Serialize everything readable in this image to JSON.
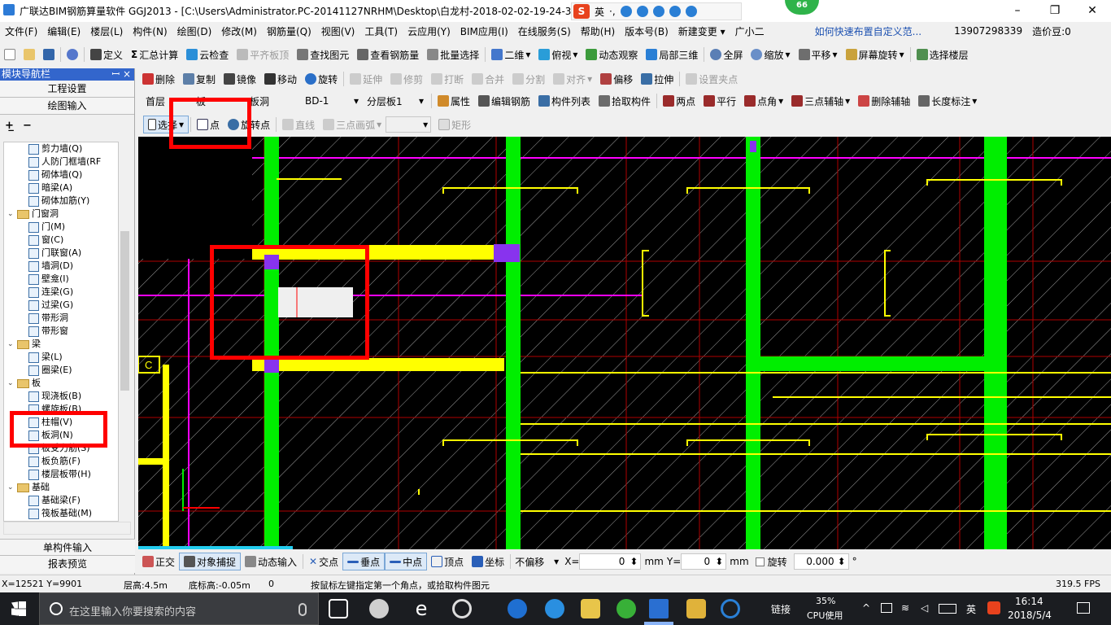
{
  "titlebar": {
    "title": "广联达BIM钢筋算量软件 GGJ2013 - [C:\\Users\\Administrator.PC-20141127NRHM\\Desktop\\白龙村-2018-02-02-19-24-35",
    "minimize": "–",
    "maximize": "❐",
    "close": "✕",
    "ime_logo": "S",
    "ime_lang": "英",
    "ime_punct": "·,",
    "badge": "66"
  },
  "menu": [
    "文件(F)",
    "编辑(E)",
    "楼层(L)",
    "构件(N)",
    "绘图(D)",
    "修改(M)",
    "钢筋量(Q)",
    "视图(V)",
    "工具(T)",
    "云应用(Y)",
    "BIM应用(I)",
    "在线服务(S)",
    "帮助(H)",
    "版本号(B)",
    "新建变更 ▾",
    "广小二"
  ],
  "menu_right": {
    "help_link": "如何快速布置自定义范...",
    "phone": "13907298339",
    "beans": "造价豆:0"
  },
  "toolbar1": [
    "定义",
    "汇总计算",
    "云检查",
    "平齐板顶",
    "查找图元",
    "查看钢筋量",
    "批量选择",
    "二维",
    "俯视",
    "动态观察",
    "局部三维",
    "全屏",
    "缩放",
    "平移",
    "屏幕旋转",
    "选择楼层"
  ],
  "toolbar2": [
    "删除",
    "复制",
    "镜像",
    "移动",
    "旋转",
    "延伸",
    "修剪",
    "打断",
    "合并",
    "分割",
    "对齐",
    "偏移",
    "拉伸",
    "设置夹点"
  ],
  "toolbar3": {
    "floor": "首层",
    "component_type": "板",
    "component": "板洞",
    "name": "BD-1",
    "layer": "分层板1",
    "buttons": [
      "属性",
      "编辑钢筋",
      "构件列表",
      "拾取构件",
      "两点",
      "平行",
      "点角",
      "三点辅轴",
      "删除辅轴",
      "长度标注"
    ]
  },
  "toolbar4": {
    "select": "选择",
    "point": "点",
    "rotate_point": "旋转点",
    "line": "直线",
    "arc": "三点画弧",
    "rect": "矩形"
  },
  "nav": {
    "header": "模块导航栏",
    "pin": "ꟷ ×",
    "sections_top": [
      "工程设置",
      "绘图输入"
    ],
    "sections_bottom": [
      "单构件输入",
      "报表预览"
    ],
    "tree": [
      {
        "label": "剪力墙(Q)",
        "level": 2,
        "type": "item"
      },
      {
        "label": "人防门框墙(RF",
        "level": 2,
        "type": "item"
      },
      {
        "label": "砌体墙(Q)",
        "level": 2,
        "type": "item"
      },
      {
        "label": "暗梁(A)",
        "level": 2,
        "type": "item"
      },
      {
        "label": "砌体加筋(Y)",
        "level": 2,
        "type": "item"
      },
      {
        "label": "门窗洞",
        "level": 1,
        "type": "folder"
      },
      {
        "label": "门(M)",
        "level": 2,
        "type": "item"
      },
      {
        "label": "窗(C)",
        "level": 2,
        "type": "item"
      },
      {
        "label": "门联窗(A)",
        "level": 2,
        "type": "item"
      },
      {
        "label": "墙洞(D)",
        "level": 2,
        "type": "item"
      },
      {
        "label": "壁龛(I)",
        "level": 2,
        "type": "item"
      },
      {
        "label": "连梁(G)",
        "level": 2,
        "type": "item"
      },
      {
        "label": "过梁(G)",
        "level": 2,
        "type": "item"
      },
      {
        "label": "带形洞",
        "level": 2,
        "type": "item"
      },
      {
        "label": "带形窗",
        "level": 2,
        "type": "item"
      },
      {
        "label": "梁",
        "level": 1,
        "type": "folder"
      },
      {
        "label": "梁(L)",
        "level": 2,
        "type": "item"
      },
      {
        "label": "圈梁(E)",
        "level": 2,
        "type": "item"
      },
      {
        "label": "板",
        "level": 1,
        "type": "folder"
      },
      {
        "label": "现浇板(B)",
        "level": 2,
        "type": "item"
      },
      {
        "label": "螺旋板(B)",
        "level": 2,
        "type": "item"
      },
      {
        "label": "柱帽(V)",
        "level": 2,
        "type": "item"
      },
      {
        "label": "板洞(N)",
        "level": 2,
        "type": "item"
      },
      {
        "label": "板受力筋(S)",
        "level": 2,
        "type": "item"
      },
      {
        "label": "板负筋(F)",
        "level": 2,
        "type": "item"
      },
      {
        "label": "楼层板带(H)",
        "level": 2,
        "type": "item"
      },
      {
        "label": "基础",
        "level": 1,
        "type": "folder"
      },
      {
        "label": "基础梁(F)",
        "level": 2,
        "type": "item"
      },
      {
        "label": "筏板基础(M)",
        "level": 2,
        "type": "item"
      }
    ]
  },
  "canvas": {
    "axis_label": "C",
    "background": "#000000",
    "beam_color": "#00ee00",
    "rebar_color": "#ffff00"
  },
  "snapbar": [
    "正交",
    "对象捕捉",
    "动态输入",
    "交点",
    "垂点",
    "中点",
    "顶点",
    "坐标"
  ],
  "snapbar_right": {
    "offset": "不偏移",
    "x_label": "X=",
    "x_value": "0",
    "mm1": "mm",
    "y_label": "Y=",
    "y_value": "0",
    "mm2": "mm",
    "rotate": "旋转",
    "rotate_value": "0.000",
    "deg": "°"
  },
  "infobar": {
    "coords": "X=12521 Y=9901",
    "floor_height": "层高:4.5m",
    "base_height": "底标高:-0.05m",
    "count": "0",
    "prompt": "按鼠标左键指定第一个角点，或拾取构件图元",
    "fps": "319.5 FPS"
  },
  "taskbar": {
    "search_placeholder": "在这里输入你要搜索的内容",
    "link": "链接",
    "cpu_percent": "35%",
    "cpu_label": "CPU使用",
    "lang": "英",
    "time": "16:14",
    "date": "2018/5/4"
  }
}
